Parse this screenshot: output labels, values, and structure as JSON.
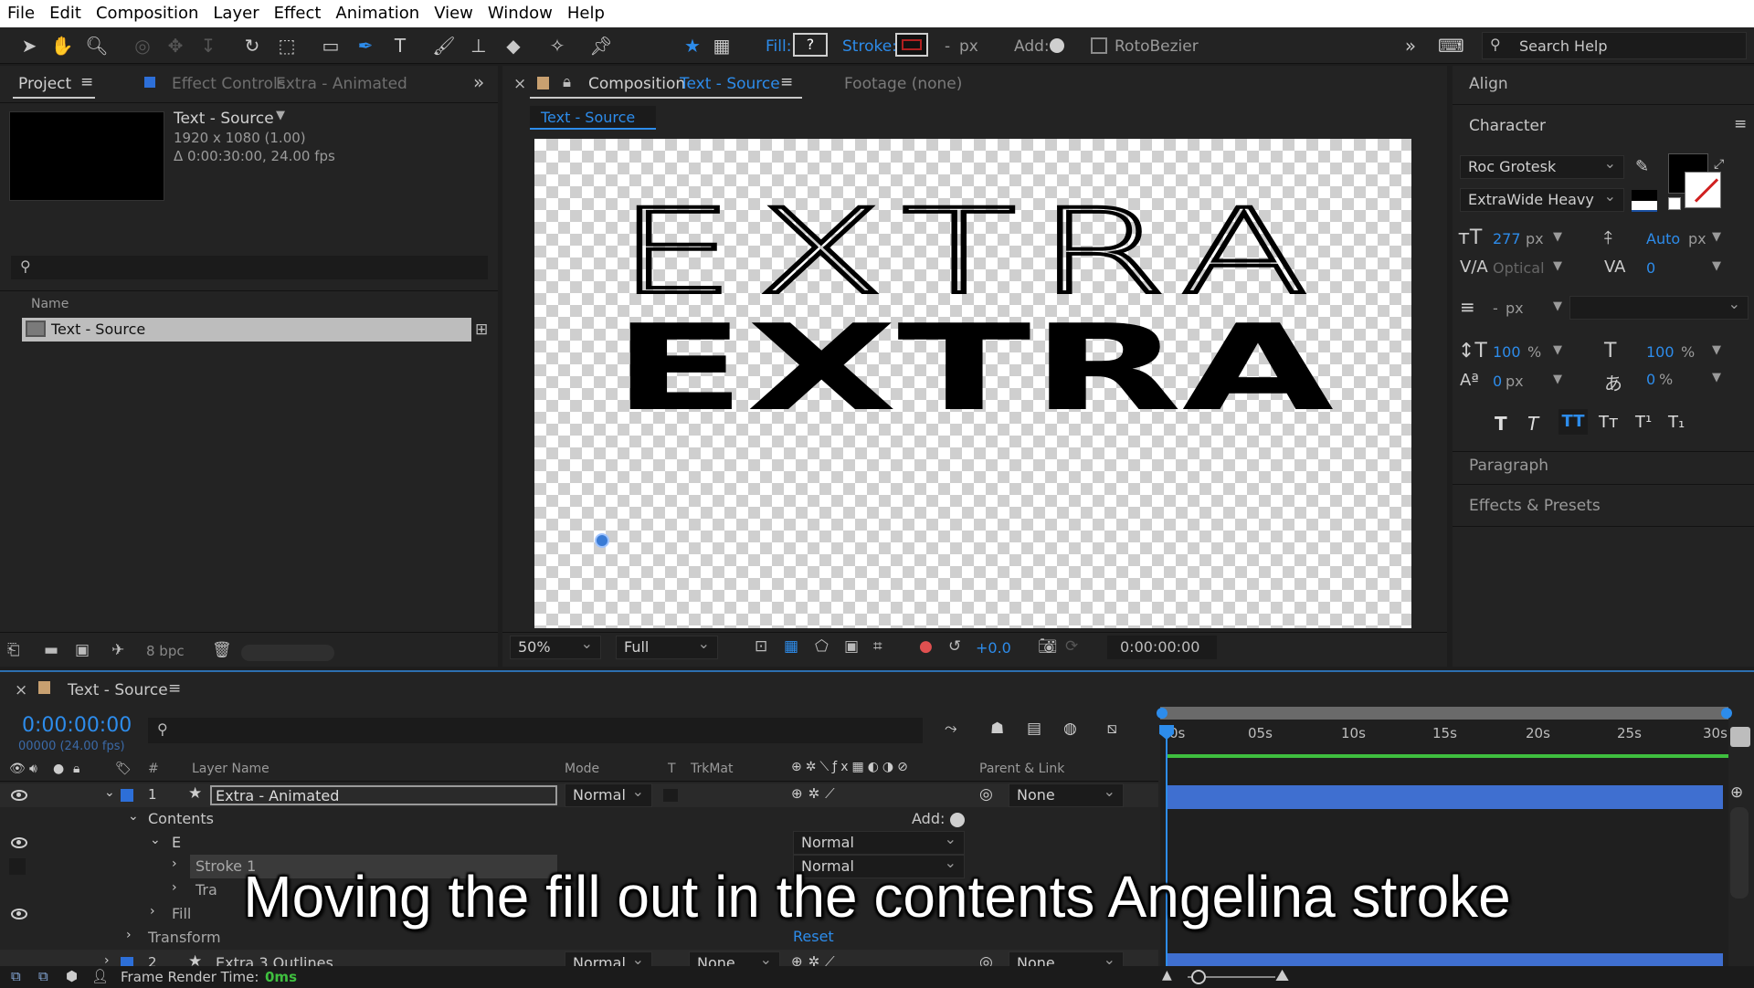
{
  "menu": [
    "File",
    "Edit",
    "Composition",
    "Layer",
    "Effect",
    "Animation",
    "View",
    "Window",
    "Help"
  ],
  "toolbar": {
    "fill_label": "Fill:",
    "fill_value": "?",
    "stroke_label": "Stroke:",
    "stroke_px": "-",
    "px": "px",
    "add_label": "Add:",
    "rotobezier": "RotoBezier",
    "search_placeholder": "Search Help"
  },
  "project": {
    "tab": "Project",
    "effect_tab": "Effect Controls",
    "effect_tab_layer": "Extra - Animated",
    "comp_name": "Text - Source",
    "comp_size": "1920 x 1080 (1.00)",
    "comp_duration": "Δ 0:00:30:00, 24.00 fps",
    "col_name": "Name",
    "item": "Text - Source",
    "bpc": "8 bpc"
  },
  "composition": {
    "tab_prefix": "Composition",
    "tab_name": "Text - Source",
    "footage_tab": "Footage (none)",
    "breadcrumb": "Text - Source",
    "line1": "EXTRA",
    "line2": "EXTRA",
    "zoom": "50%",
    "resolution": "Full",
    "exposure": "+0.0",
    "timecode": "0:00:00:00"
  },
  "right_panels": {
    "align": "Align",
    "character": "Character",
    "font": "Roc Grotesk",
    "style": "ExtraWide Heavy",
    "font_size": "277",
    "leading": "Auto",
    "kerning": "Optical",
    "tracking": "0",
    "stroke_px": "-",
    "vscale": "100",
    "hscale": "100",
    "baseline": "0",
    "tsume": "0",
    "px": "px",
    "pct": "%",
    "paragraph": "Paragraph",
    "effects": "Effects & Presets"
  },
  "timeline": {
    "tab": "Text - Source",
    "timecode": "0:00:00:00",
    "frames": "00000 (24.00 fps)",
    "headers": {
      "layer_name": "Layer Name",
      "mode": "Mode",
      "t": "T",
      "trkmat": "TrkMat",
      "parent": "Parent & Link",
      "num": "#"
    },
    "ticks": [
      "0s",
      "05s",
      "10s",
      "15s",
      "20s",
      "25s",
      "30s"
    ],
    "layer1": {
      "num": "1",
      "name": "Extra - Animated",
      "mode": "Normal",
      "parent": "None"
    },
    "contents": "Contents",
    "add": "Add:",
    "group_e": "E",
    "group_mode": "Normal",
    "stroke1": "Stroke 1",
    "stroke_mode": "Normal",
    "trans": "Tra",
    "fill": "Fill",
    "transform": "Transform",
    "reset": "Reset",
    "layer2": {
      "num": "2",
      "name": "Extra 3 Outlines",
      "mode": "Normal",
      "trkmat": "None",
      "parent": "None"
    },
    "render_label": "Frame Render Time:",
    "render_value": "0ms"
  },
  "caption": "Moving the fill out in the contents Angelina stroke",
  "colors": {
    "accent": "#2d8ceb",
    "layer_bar": "#3f6fd0",
    "workarea": "#3fbf3f"
  }
}
